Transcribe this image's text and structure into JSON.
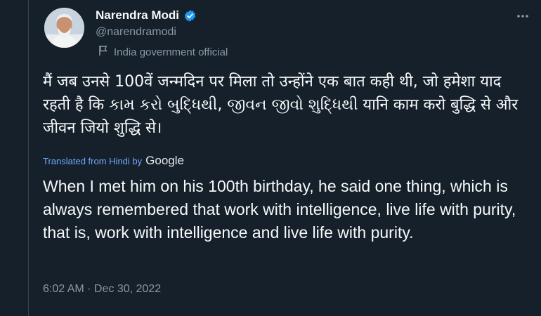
{
  "user": {
    "name": "Narendra Modi",
    "handle": "@narendramodi",
    "label": "India government official"
  },
  "tweet": {
    "text": "मैं जब उनसे 100वें जन्मदिन पर मिला तो उन्होंने एक बात कही थी, जो हमेशा याद रहती है कि કામ કરો બુદ્ધિથી, જીવન જીવો શુદ્ધિથી यानि काम करो बुद्धि से और जीवन जियो शुद्धि से।",
    "translated_prefix": "Translated from Hindi by",
    "translator": "Google",
    "translation": "When I met him on his 100th birthday, he said one thing, which is always remembered that work with intelligence, live life with purity, that is, work with intelligence and live life with purity.",
    "timestamp": "6:02 AM · Dec 30, 2022"
  },
  "icons": {
    "verified": "verified-badge-icon",
    "flag": "flag-icon",
    "more": "more-options-icon"
  },
  "colors": {
    "background": "#15202b",
    "verified": "#1d9bf0",
    "link": "#6ea8fe",
    "secondary": "#8b98a5"
  }
}
